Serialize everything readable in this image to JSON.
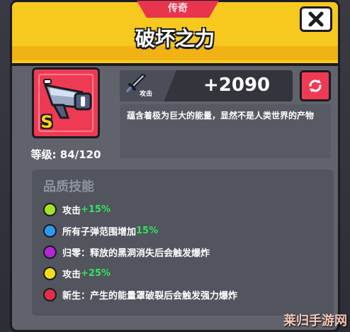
{
  "header": {
    "rarity": "传奇",
    "title": "破坏之力"
  },
  "weapon": {
    "grade": "S",
    "level_label": "等级: 84/120"
  },
  "stat": {
    "label": "攻击",
    "value": "+2090"
  },
  "description": "蕴含着极为巨大的能量，显然不是人类世界的产物",
  "skills": {
    "title": "品质技能",
    "items": [
      {
        "prefix": "攻击",
        "highlight": "+15%",
        "dot_color": "#a3e42a"
      },
      {
        "prefix": "所有子弹范围增加",
        "highlight": "15%",
        "dot_color": "#2b9bf0"
      },
      {
        "prefix": "归零：释放的黑洞消失后会触发爆炸",
        "highlight": "",
        "dot_color": "#b227d6"
      },
      {
        "prefix": "攻击",
        "highlight": "+25%",
        "dot_color": "#f3dc1a"
      },
      {
        "prefix": "新生：产生的能量罩破裂后会触发强力爆炸",
        "highlight": "",
        "dot_color": "#e52d48"
      }
    ]
  },
  "watermark": "莱归手游网",
  "colors": {
    "header": "#f7c81e",
    "accent_red": "#ee3b53",
    "highlight_green": "#33e35c"
  }
}
